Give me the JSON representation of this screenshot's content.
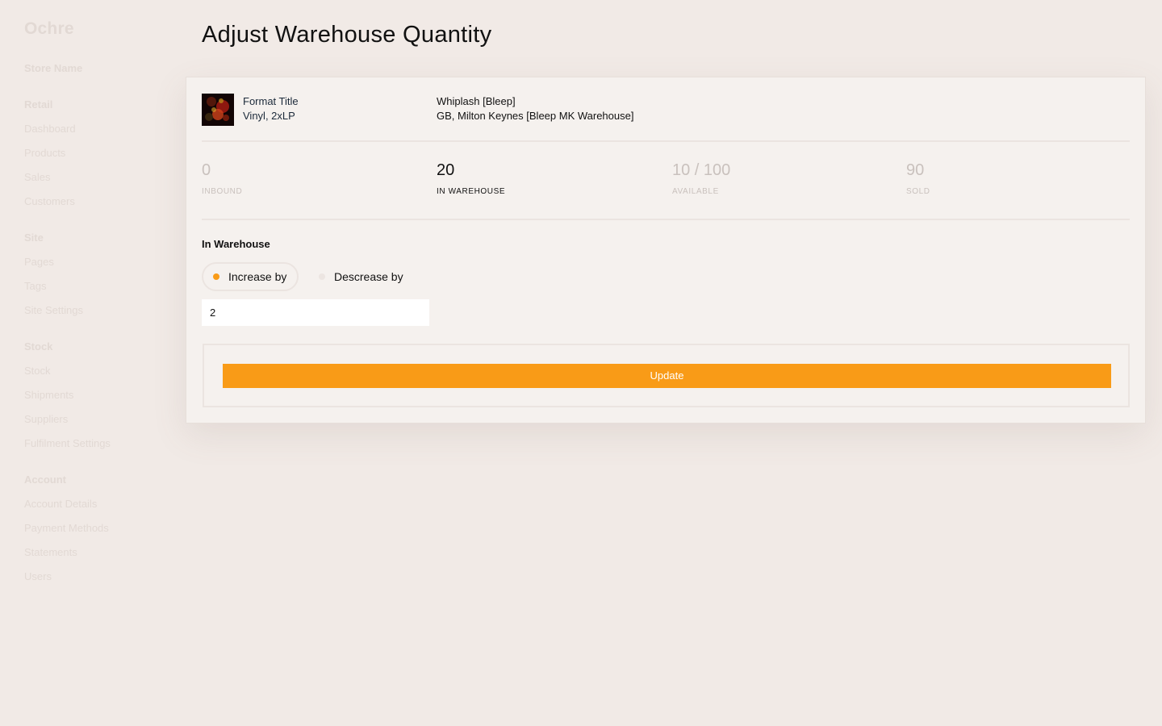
{
  "app": {
    "logo": "Ochre",
    "store_name": "Store Name"
  },
  "sidebar": {
    "sections": [
      {
        "heading": "Retail",
        "items": [
          "Dashboard",
          "Products",
          "Sales",
          "Customers"
        ]
      },
      {
        "heading": "Site",
        "items": [
          "Pages",
          "Tags",
          "Site Settings"
        ]
      },
      {
        "heading": "Stock",
        "items": [
          "Stock",
          "Shipments",
          "Suppliers",
          "Fulfilment Settings"
        ]
      },
      {
        "heading": "Account",
        "items": [
          "Account Details",
          "Payment Methods",
          "Statements",
          "Users"
        ]
      }
    ]
  },
  "page": {
    "title": "Adjust Warehouse Quantity"
  },
  "product": {
    "format_title": "Format Title",
    "format_sub": "Vinyl, 2xLP",
    "release_title": "Whiplash [Bleep]",
    "warehouse": "GB, Milton Keynes [Bleep MK Warehouse]"
  },
  "stats": {
    "inbound": {
      "value": "0",
      "label": "INBOUND"
    },
    "in_warehouse": {
      "value": "20",
      "label": "IN WAREHOUSE"
    },
    "available": {
      "value": "10 / 100",
      "label": "AVAILABLE"
    },
    "sold": {
      "value": "90",
      "label": "SOLD"
    }
  },
  "form": {
    "section_label": "In Warehouse",
    "increase_label": "Increase by",
    "decrease_label": "Descrease by",
    "selected": "increase",
    "quantity": "2",
    "update_label": "Update"
  },
  "colors": {
    "accent": "#f99b17",
    "background": "#f1eae6",
    "card": "#f5f1ee"
  }
}
